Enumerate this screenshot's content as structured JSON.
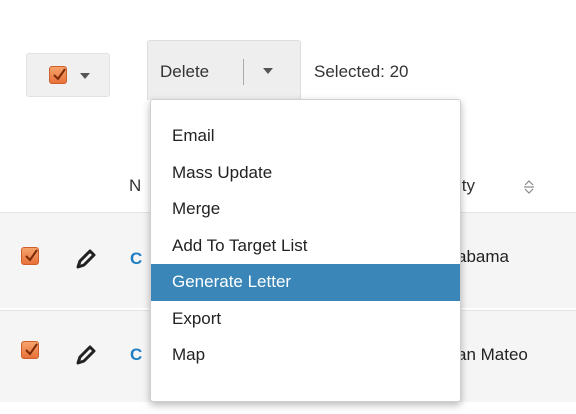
{
  "toolbar": {
    "delete_label": "Delete",
    "selected_text": "Selected:  20"
  },
  "table": {
    "header_name_fragment": "N",
    "header_city_fragment": "ity",
    "rows": [
      {
        "name_fragment": "C",
        "city_fragment": "abama",
        "checked": true
      },
      {
        "name_fragment": "C",
        "city_fragment": "an Mateo",
        "checked": true
      }
    ]
  },
  "menu": {
    "items": [
      {
        "label": "Email"
      },
      {
        "label": "Mass Update"
      },
      {
        "label": "Merge"
      },
      {
        "label": "Add To Target List"
      },
      {
        "label": "Generate Letter",
        "highlighted": true
      },
      {
        "label": "Export"
      },
      {
        "label": "Map"
      }
    ]
  },
  "colors": {
    "checkbox": "#e8703a",
    "highlight": "#3a86b8",
    "link": "#1f7fc2"
  },
  "icons": [
    "checkbox-checked-icon",
    "chevron-down-icon",
    "pencil-icon",
    "sort-icon"
  ]
}
